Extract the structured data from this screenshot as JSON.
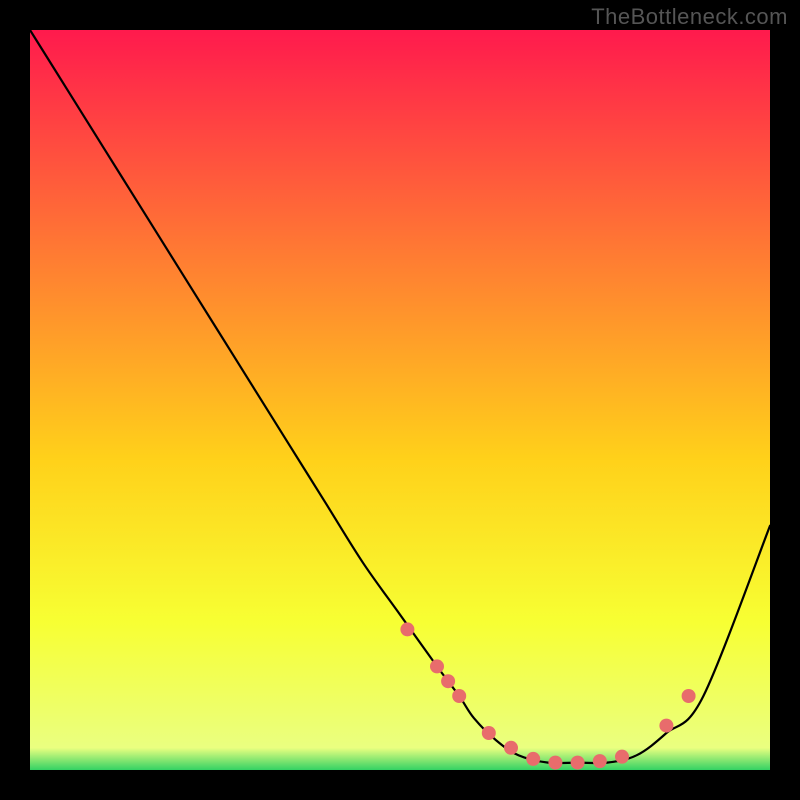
{
  "watermark": "TheBottleneck.com",
  "chart_data": {
    "type": "line",
    "title": "",
    "xlabel": "",
    "ylabel": "",
    "xlim": [
      0,
      100
    ],
    "ylim": [
      0,
      100
    ],
    "series": [
      {
        "name": "bottleneck-curve",
        "x": [
          0,
          5,
          10,
          15,
          20,
          25,
          30,
          35,
          40,
          45,
          50,
          55,
          58,
          60,
          63,
          66,
          70,
          74,
          78,
          82,
          86,
          91,
          100
        ],
        "values": [
          100,
          92,
          84,
          76,
          68,
          60,
          52,
          44,
          36,
          28,
          21,
          14,
          10,
          7,
          4,
          2,
          1,
          1,
          1,
          2,
          5,
          10,
          33
        ],
        "marker_x": [
          51,
          55,
          56.5,
          58,
          62,
          65,
          68,
          71,
          74,
          77,
          80,
          86,
          89
        ],
        "marker_values": [
          19,
          14,
          12,
          10,
          5,
          3,
          1.5,
          1,
          1,
          1.2,
          1.8,
          6,
          10
        ]
      }
    ],
    "background": {
      "type": "vertical-gradient",
      "stops": [
        {
          "offset": 0.0,
          "color": "#ff1a4d"
        },
        {
          "offset": 0.3,
          "color": "#ff7a33"
        },
        {
          "offset": 0.58,
          "color": "#ffd11a"
        },
        {
          "offset": 0.8,
          "color": "#f7ff33"
        },
        {
          "offset": 0.97,
          "color": "#eaff80"
        },
        {
          "offset": 1.0,
          "color": "#33d264"
        }
      ]
    },
    "marker_color": "#e86c6c"
  }
}
